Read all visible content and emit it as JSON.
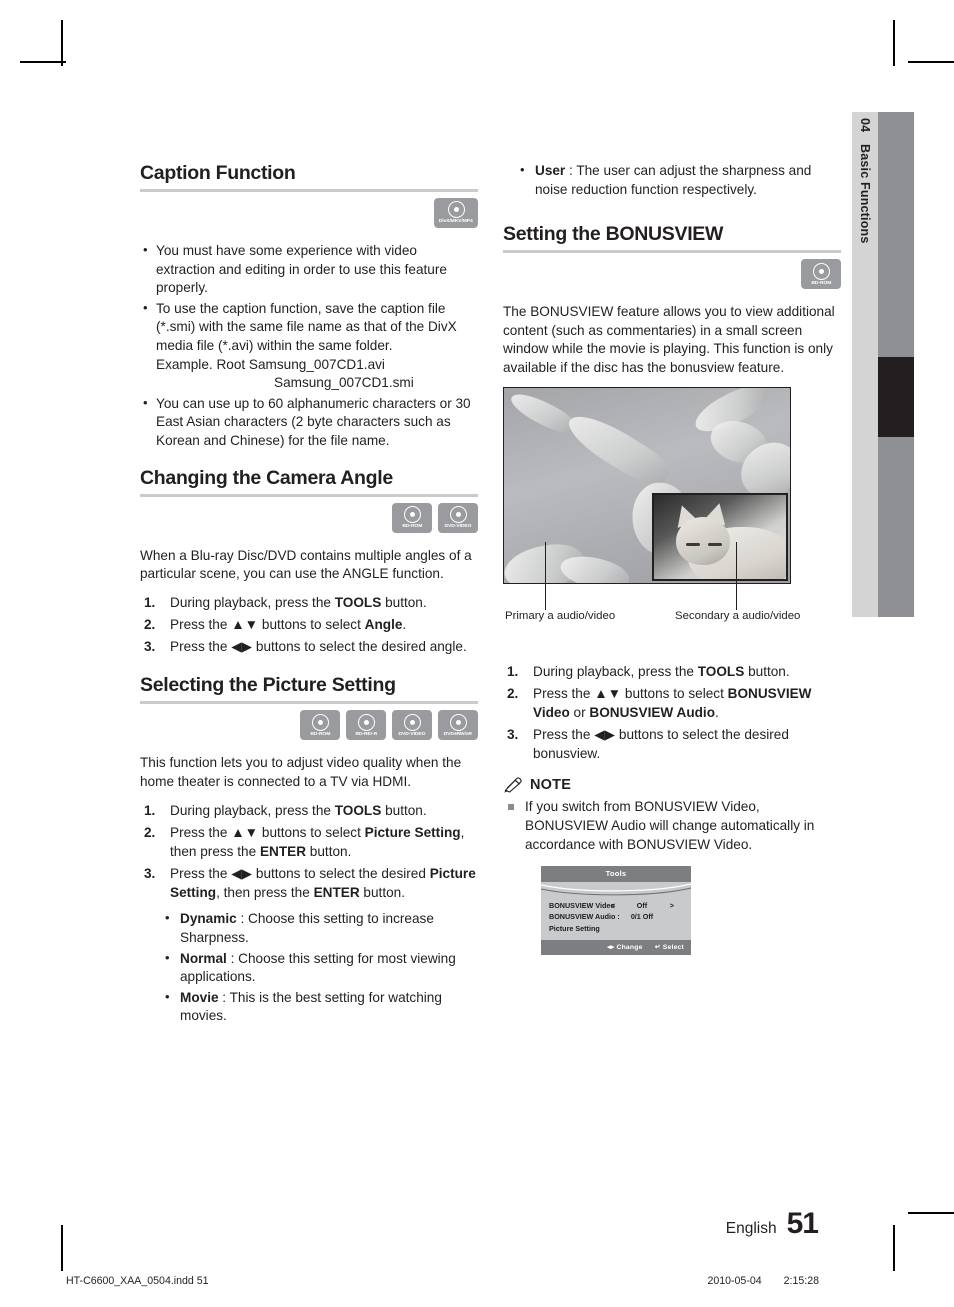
{
  "chapter": {
    "number": "04",
    "name": "Basic Functions"
  },
  "left_column": {
    "caption_function": {
      "heading": "Caption Function",
      "disc_icons": [
        {
          "label": "DivX/MKV/MP4",
          "name": "divx-mkv-mp4"
        }
      ],
      "bullets": [
        "You must have some experience with video extraction and editing in order to use this feature properly.",
        "To use the caption function, save the caption file (*.smi) with the same file name as that of the DivX media file (*.avi) within the same folder.",
        "You can use up to 60 alphanumeric characters or 30 East Asian characters (2 byte characters such as Korean and Chinese) for the file name."
      ],
      "example_line_1": "Example. Root Samsung_007CD1.avi",
      "example_line_2": "Samsung_007CD1.smi"
    },
    "camera_angle": {
      "heading": "Changing the Camera Angle",
      "disc_icons": [
        {
          "label": "BD-ROM",
          "name": "bd-rom"
        },
        {
          "label": "DVD-VIDEO",
          "name": "dvd-video"
        }
      ],
      "intro": "When a Blu-ray Disc/DVD contains multiple angles of a particular scene, you can use the ANGLE function.",
      "steps": [
        {
          "num": "1.",
          "pre": "During playback, press the ",
          "bold": "TOOLS",
          "post": " button."
        },
        {
          "num": "2.",
          "pre": "Press the ▲▼ buttons to select ",
          "bold": "Angle",
          "post": "."
        },
        {
          "num": "3.",
          "pre": "Press the ◀▶ buttons to select the desired angle.",
          "bold": "",
          "post": ""
        }
      ]
    },
    "picture_setting": {
      "heading": "Selecting the Picture Setting",
      "disc_icons": [
        {
          "label": "BD-ROM",
          "name": "bd-rom"
        },
        {
          "label": "BD-RE/-R",
          "name": "bd-re-r"
        },
        {
          "label": "DVD-VIDEO",
          "name": "dvd-video"
        },
        {
          "label": "DVD±RW/±R",
          "name": "dvd-rw-r"
        }
      ],
      "intro": "This function lets you to adjust video quality when the home theater is connected to a TV via HDMI.",
      "steps": [
        {
          "num": "1.",
          "html": "During playback, press the <span class=\"b\">TOOLS</span> button."
        },
        {
          "num": "2.",
          "html": "Press the ▲▼ buttons to select <span class=\"b\">Picture Setting</span>, then press the <span class=\"b\">ENTER</span> button."
        },
        {
          "num": "3.",
          "html": "Press the ◀▶ buttons to select the desired <span class=\"b\">Picture Setting</span>, then press the <span class=\"b\">ENTER</span> button."
        }
      ],
      "options": [
        {
          "term": "Dynamic",
          "desc": " : Choose this setting to increase Sharpness."
        },
        {
          "term": "Normal",
          "desc": " : Choose this setting for most viewing applications."
        },
        {
          "term": "Movie",
          "desc": " : This is the best setting for watching movies."
        }
      ]
    }
  },
  "right_column": {
    "top_option": {
      "term": "User",
      "desc": " : The user can adjust the sharpness and noise reduction function respectively."
    },
    "bonusview": {
      "heading": "Setting the BONUSVIEW",
      "disc_icons": [
        {
          "label": "BD-ROM",
          "name": "bd-rom"
        }
      ],
      "intro": "The BONUSVIEW feature allows you to view additional content (such as commentaries) in a small screen window while the movie is playing. This function is only available if the disc has the bonusview feature.",
      "figure_captions": {
        "primary": "Primary a audio/video",
        "secondary": "Secondary a audio/video"
      },
      "steps": [
        {
          "num": "1.",
          "html": "During playback, press the <span class=\"b\">TOOLS</span> button."
        },
        {
          "num": "2.",
          "html": "Press the ▲▼ buttons to select <span class=\"b\">BONUSVIEW Video</span> or <span class=\"b\">BONUSVIEW Audio</span>."
        },
        {
          "num": "3.",
          "html": "Press the ◀▶ buttons to select the desired bonusview."
        }
      ]
    },
    "note": {
      "title": "NOTE",
      "items": [
        "If you switch from BONUSVIEW Video, BONUSVIEW Audio will change automatically in accordance with BONUSVIEW Video."
      ]
    },
    "osd": {
      "title": "Tools",
      "rows": [
        {
          "name": "BONUSVIEW Video",
          "left_arrow": "<",
          "value": "Off",
          "right_arrow": ">"
        },
        {
          "name": "BONUSVIEW Audio :",
          "left_arrow": "",
          "value": "0/1 Off",
          "right_arrow": ""
        },
        {
          "name": "Picture Setting",
          "left_arrow": "",
          "value": "",
          "right_arrow": ""
        }
      ],
      "footer_change": "◂▸ Change",
      "footer_select": "↵ Select"
    }
  },
  "footer": {
    "language": "English",
    "page_number": "51",
    "file_name": "HT-C6600_XAA_0504.indd   51",
    "date": "2010-05-04",
    "time": "2:15:28"
  }
}
